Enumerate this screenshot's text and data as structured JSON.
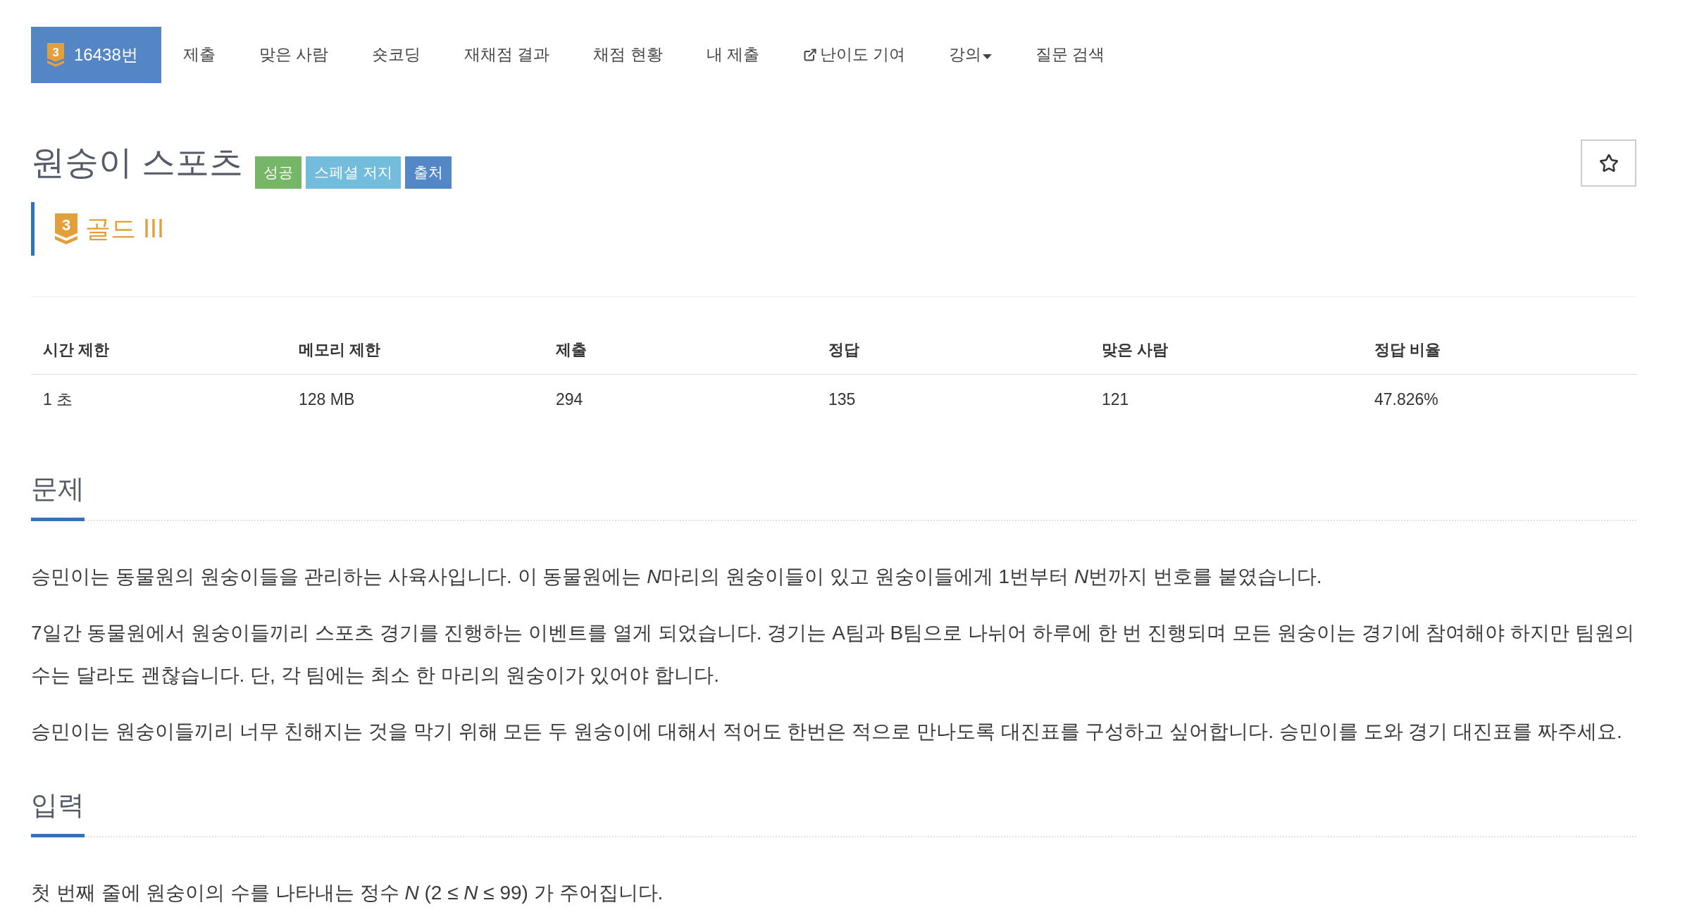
{
  "nav": {
    "tabs": [
      {
        "kind": "problem",
        "label": "16438번",
        "tier_digit": "3",
        "selected": true
      },
      {
        "kind": "link",
        "label": "제출",
        "selected": false
      },
      {
        "kind": "link",
        "label": "맞은 사람",
        "selected": false
      },
      {
        "kind": "link",
        "label": "숏코딩",
        "selected": false
      },
      {
        "kind": "link",
        "label": "재채점 결과",
        "selected": false
      },
      {
        "kind": "link",
        "label": "채점 현황",
        "selected": false
      },
      {
        "kind": "link",
        "label": "내 제출",
        "selected": false
      },
      {
        "kind": "external",
        "label": "난이도 기여",
        "selected": false
      },
      {
        "kind": "dropdown",
        "label": "강의",
        "selected": false
      },
      {
        "kind": "link",
        "label": "질문 검색",
        "selected": false
      }
    ]
  },
  "problem": {
    "title": "원숭이 스포츠",
    "labels": [
      {
        "text": "성공",
        "color": "#76b667"
      },
      {
        "text": "스페셜 저지",
        "color": "#74bcdb"
      },
      {
        "text": "출처",
        "color": "#5487c6"
      }
    ],
    "favorite": {
      "starred": false
    },
    "tier": {
      "digit": "3",
      "name": "골드 III"
    }
  },
  "table": {
    "columns": [
      "시간 제한",
      "메모리 제한",
      "제출",
      "정답",
      "맞은 사람",
      "정답 비율"
    ],
    "rows": [
      [
        "1 초",
        "128 MB",
        "294",
        "135",
        "121",
        "47.826%"
      ]
    ]
  },
  "sections": [
    {
      "heading": "문제",
      "paragraphs": [
        [
          {
            "text": "승민이는 동물원의 원숭이들을 관리하는 사육사입니다. 이 동물원에는 ",
            "italic": false
          },
          {
            "text": "N",
            "italic": true
          },
          {
            "text": "마리의 원숭이들이 있고 원숭이들에게 1번부터 ",
            "italic": false
          },
          {
            "text": "N",
            "italic": true
          },
          {
            "text": "번까지 번호를 붙였습니다.",
            "italic": false
          }
        ],
        [
          {
            "text": "7일간 동물원에서 원숭이들끼리 스포츠 경기를 진행하는 이벤트를 열게 되었습니다. 경기는 A팀과 B팀으로 나뉘어 하루에 한 번 진행되며 모든 원숭이는 경기에 참여해야 하지만 팀원의 수는 달라도 괜찮습니다. 단, 각 팀에는 최소 한 마리의 원숭이가 있어야 합니다.",
            "italic": false
          }
        ],
        [
          {
            "text": "승민이는 원숭이들끼리 너무 친해지는 것을 막기 위해 모든 두 원숭이에 대해서 적어도 한번은 적으로 만나도록 대진표를 구성하고 싶어합니다. 승민이를 도와 경기 대진표를 짜주세요.",
            "italic": false
          }
        ]
      ]
    },
    {
      "heading": "입력",
      "paragraphs": [
        [
          {
            "text": "첫 번째 줄에 원숭이의 수를 나타내는 정수 ",
            "italic": false
          },
          {
            "text": "N",
            "italic": true
          },
          {
            "text": " (2 ≤ ",
            "italic": false
          },
          {
            "text": "N",
            "italic": true
          },
          {
            "text": " ≤ 99) 가 주어집니다.",
            "italic": false
          }
        ]
      ]
    }
  ]
}
